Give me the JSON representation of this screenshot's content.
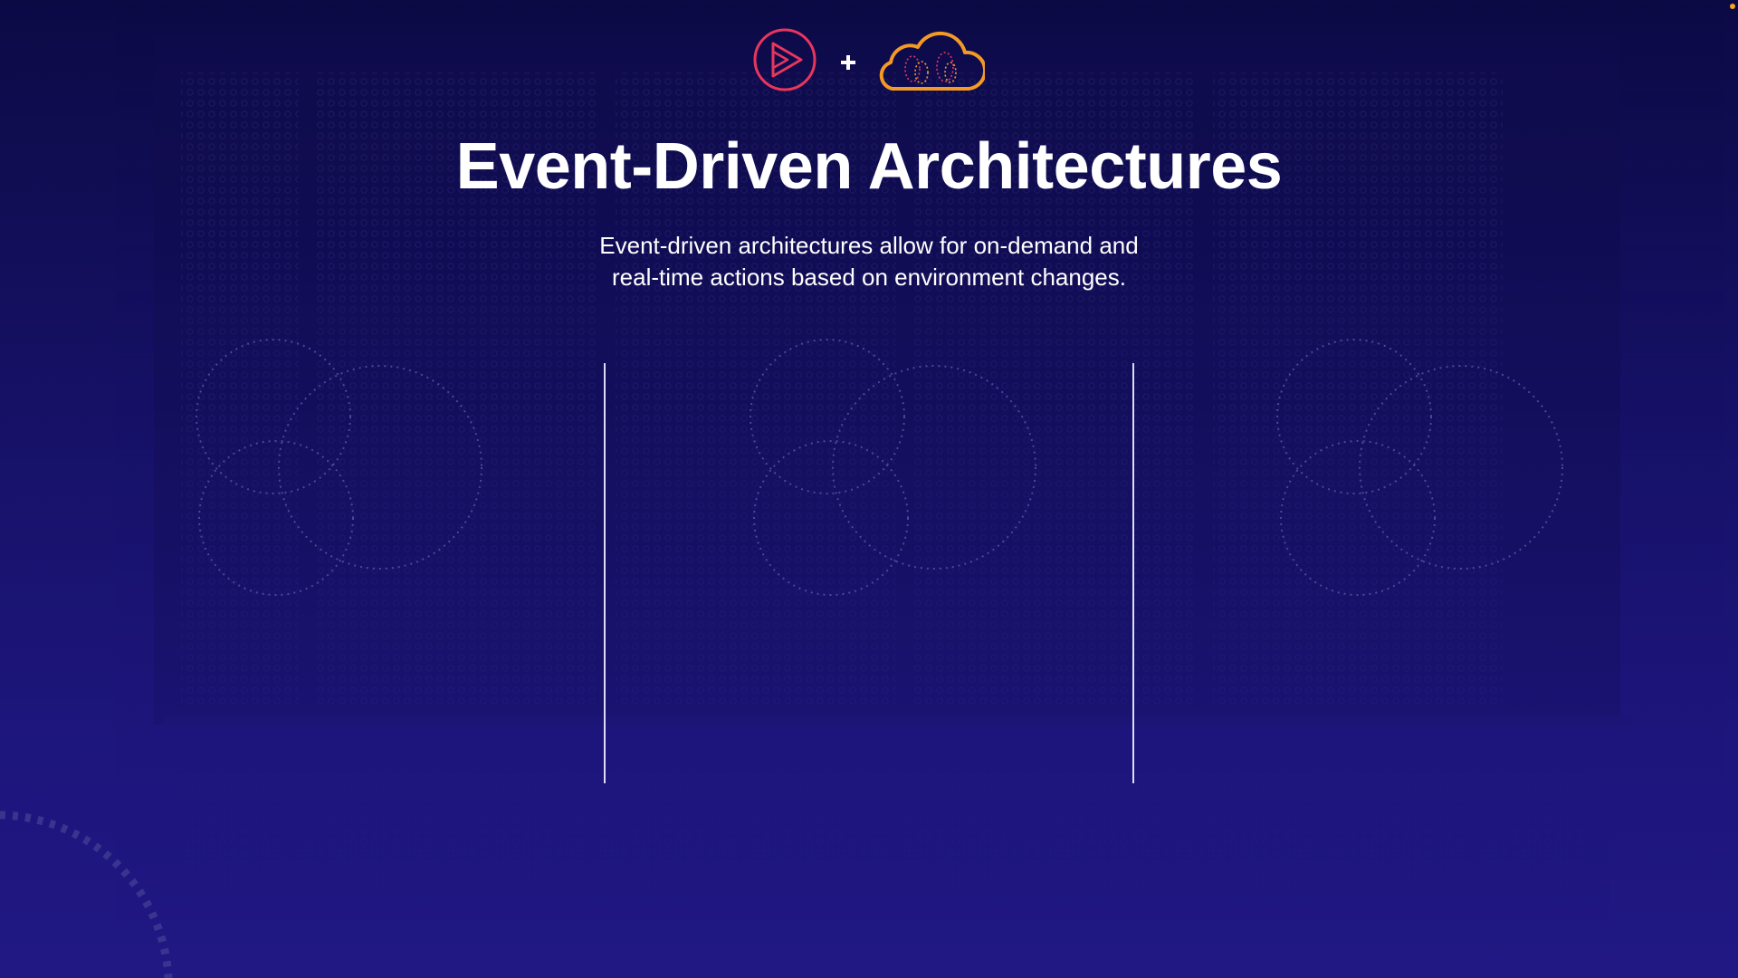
{
  "slide": {
    "title": "Event-Driven Architectures",
    "subtitle_lines": [
      "Event-driven architectures allow for on-demand and",
      "real-time actions based on environment changes."
    ]
  },
  "logos": {
    "left_icon": "play-logo-icon",
    "separator": "+",
    "right_icon": "cloud-logo-icon"
  },
  "colors": {
    "background_top": "#0c0a45",
    "background_bottom": "#211884",
    "play_logo": "#e8365d",
    "cloud_logo": "#f39a26",
    "text": "#ffffff",
    "corner_dot": "#f5a623"
  }
}
